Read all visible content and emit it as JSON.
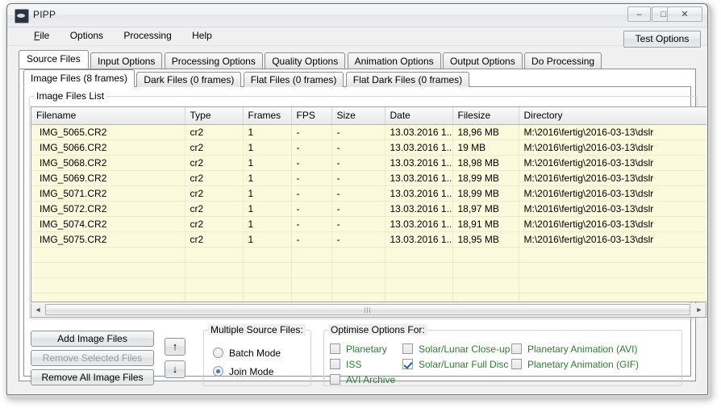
{
  "window": {
    "title": "PIPP",
    "icon": "planet-icon",
    "controls": {
      "minimize": "–",
      "maximize": "□",
      "close": "✕"
    }
  },
  "menu": {
    "items": [
      {
        "label": "File",
        "accel": "F",
        "rest": "ile"
      },
      {
        "label": "Options",
        "accel": "",
        "rest": "Options"
      },
      {
        "label": "Processing",
        "accel": "",
        "rest": "Processing"
      },
      {
        "label": "Help",
        "accel": "",
        "rest": "Help"
      }
    ]
  },
  "toolbar": {
    "test_options_label": "Test Options"
  },
  "tabs": {
    "items": [
      {
        "label": "Source Files",
        "active": true
      },
      {
        "label": "Input Options",
        "active": false
      },
      {
        "label": "Processing Options",
        "active": false
      },
      {
        "label": "Quality Options",
        "active": false
      },
      {
        "label": "Animation Options",
        "active": false
      },
      {
        "label": "Output Options",
        "active": false
      },
      {
        "label": "Do Processing",
        "active": false
      }
    ]
  },
  "subtabs": {
    "items": [
      {
        "label": "Image Files (8 frames)",
        "active": true
      },
      {
        "label": "Dark Files (0 frames)",
        "active": false
      },
      {
        "label": "Flat Files (0 frames)",
        "active": false
      },
      {
        "label": "Flat Dark Files (0 frames)",
        "active": false
      }
    ]
  },
  "files_group": {
    "legend": "Image Files List"
  },
  "table": {
    "columns": [
      "Filename",
      "Type",
      "Frames",
      "FPS",
      "Size",
      "Date",
      "Filesize",
      "Directory"
    ],
    "rows": [
      [
        "IMG_5065.CR2",
        "cr2",
        "1",
        "-",
        "-",
        "13.03.2016 1...",
        "18,96 MB",
        "M:\\2016\\fertig\\2016-03-13\\dslr"
      ],
      [
        "IMG_5066.CR2",
        "cr2",
        "1",
        "-",
        "-",
        "13.03.2016 1...",
        "19 MB",
        "M:\\2016\\fertig\\2016-03-13\\dslr"
      ],
      [
        "IMG_5068.CR2",
        "cr2",
        "1",
        "-",
        "-",
        "13.03.2016 1...",
        "18,98 MB",
        "M:\\2016\\fertig\\2016-03-13\\dslr"
      ],
      [
        "IMG_5069.CR2",
        "cr2",
        "1",
        "-",
        "-",
        "13.03.2016 1...",
        "18,99 MB",
        "M:\\2016\\fertig\\2016-03-13\\dslr"
      ],
      [
        "IMG_5071.CR2",
        "cr2",
        "1",
        "-",
        "-",
        "13.03.2016 1...",
        "18,99 MB",
        "M:\\2016\\fertig\\2016-03-13\\dslr"
      ],
      [
        "IMG_5072.CR2",
        "cr2",
        "1",
        "-",
        "-",
        "13.03.2016 1...",
        "18,97 MB",
        "M:\\2016\\fertig\\2016-03-13\\dslr"
      ],
      [
        "IMG_5074.CR2",
        "cr2",
        "1",
        "-",
        "-",
        "13.03.2016 1...",
        "18,91 MB",
        "M:\\2016\\fertig\\2016-03-13\\dslr"
      ],
      [
        "IMG_5075.CR2",
        "cr2",
        "1",
        "-",
        "-",
        "13.03.2016 1...",
        "18,95 MB",
        "M:\\2016\\fertig\\2016-03-13\\dslr"
      ]
    ],
    "empty_row_count": 5,
    "row_background": "#fcf9dd"
  },
  "scrollbar": {
    "left_arrow": "◄",
    "right_arrow": "►",
    "grip": "|||"
  },
  "buttons": {
    "add_image_files": "Add Image Files",
    "remove_selected_files": "Remove Selected Files",
    "remove_all_image_files": "Remove All Image Files",
    "move_up": "↑",
    "move_down": "↓"
  },
  "multiple_source_files": {
    "legend": "Multiple Source Files:",
    "options": [
      {
        "label": "Batch Mode",
        "selected": false
      },
      {
        "label": "Join Mode",
        "selected": true
      }
    ]
  },
  "optimise_options": {
    "legend": "Optimise Options For:",
    "label_color": "#2e7d32",
    "column1": [
      {
        "label": "Planetary",
        "checked": false
      },
      {
        "label": "ISS",
        "checked": false
      },
      {
        "label": "AVI Archive",
        "checked": false
      }
    ],
    "column2": [
      {
        "label": "Solar/Lunar Close-up",
        "checked": false
      },
      {
        "label": "Solar/Lunar Full Disc",
        "checked": true
      }
    ],
    "column3": [
      {
        "label": "Planetary Animation (AVI)",
        "checked": false
      },
      {
        "label": "Planetary Animation (GIF)",
        "checked": false
      }
    ]
  }
}
